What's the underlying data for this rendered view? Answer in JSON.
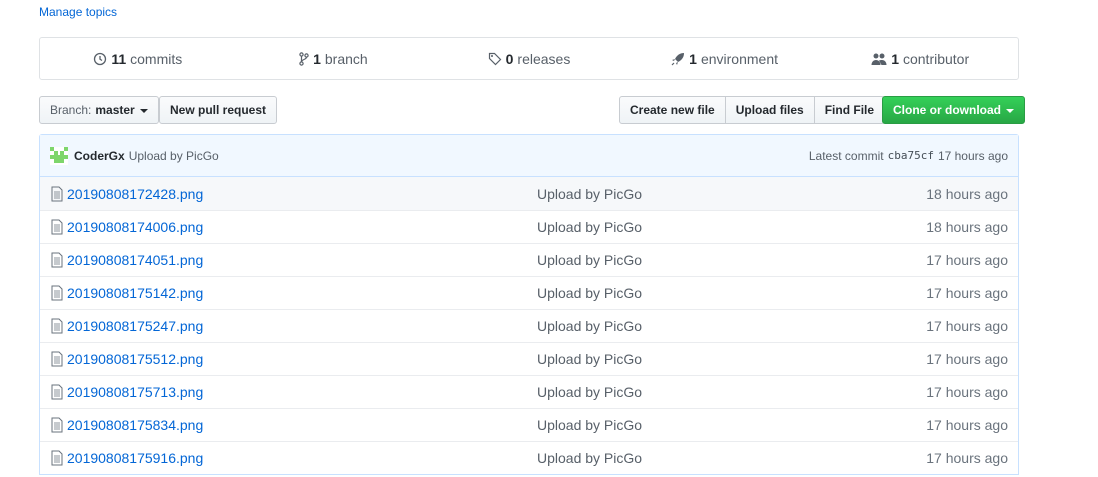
{
  "manage_topics": "Manage topics",
  "summary": {
    "commits": {
      "count": "11",
      "label": "commits"
    },
    "branches": {
      "count": "1",
      "label": "branch"
    },
    "releases": {
      "count": "0",
      "label": "releases"
    },
    "environments": {
      "count": "1",
      "label": "environment"
    },
    "contributors": {
      "count": "1",
      "label": "contributor"
    }
  },
  "toolbar": {
    "branch_prefix": "Branch:",
    "branch_name": "master",
    "new_pr": "New pull request",
    "create_file": "Create new file",
    "upload_files": "Upload files",
    "find_file": "Find File",
    "clone": "Clone or download"
  },
  "commit": {
    "author": "CoderGx",
    "message": "Upload by PicGo",
    "latest_label": "Latest commit",
    "sha": "cba75cf",
    "age": "17 hours ago"
  },
  "files": [
    {
      "name": "20190808172428.png",
      "message": "Upload by PicGo",
      "age": "18 hours ago"
    },
    {
      "name": "20190808174006.png",
      "message": "Upload by PicGo",
      "age": "18 hours ago"
    },
    {
      "name": "20190808174051.png",
      "message": "Upload by PicGo",
      "age": "17 hours ago"
    },
    {
      "name": "20190808175142.png",
      "message": "Upload by PicGo",
      "age": "17 hours ago"
    },
    {
      "name": "20190808175247.png",
      "message": "Upload by PicGo",
      "age": "17 hours ago"
    },
    {
      "name": "20190808175512.png",
      "message": "Upload by PicGo",
      "age": "17 hours ago"
    },
    {
      "name": "20190808175713.png",
      "message": "Upload by PicGo",
      "age": "17 hours ago"
    },
    {
      "name": "20190808175834.png",
      "message": "Upload by PicGo",
      "age": "17 hours ago"
    },
    {
      "name": "20190808175916.png",
      "message": "Upload by PicGo",
      "age": "17 hours ago"
    }
  ],
  "colors": {
    "link": "#0366d6",
    "accent_green": "#28a745",
    "commit_bg": "#f1f8ff"
  }
}
